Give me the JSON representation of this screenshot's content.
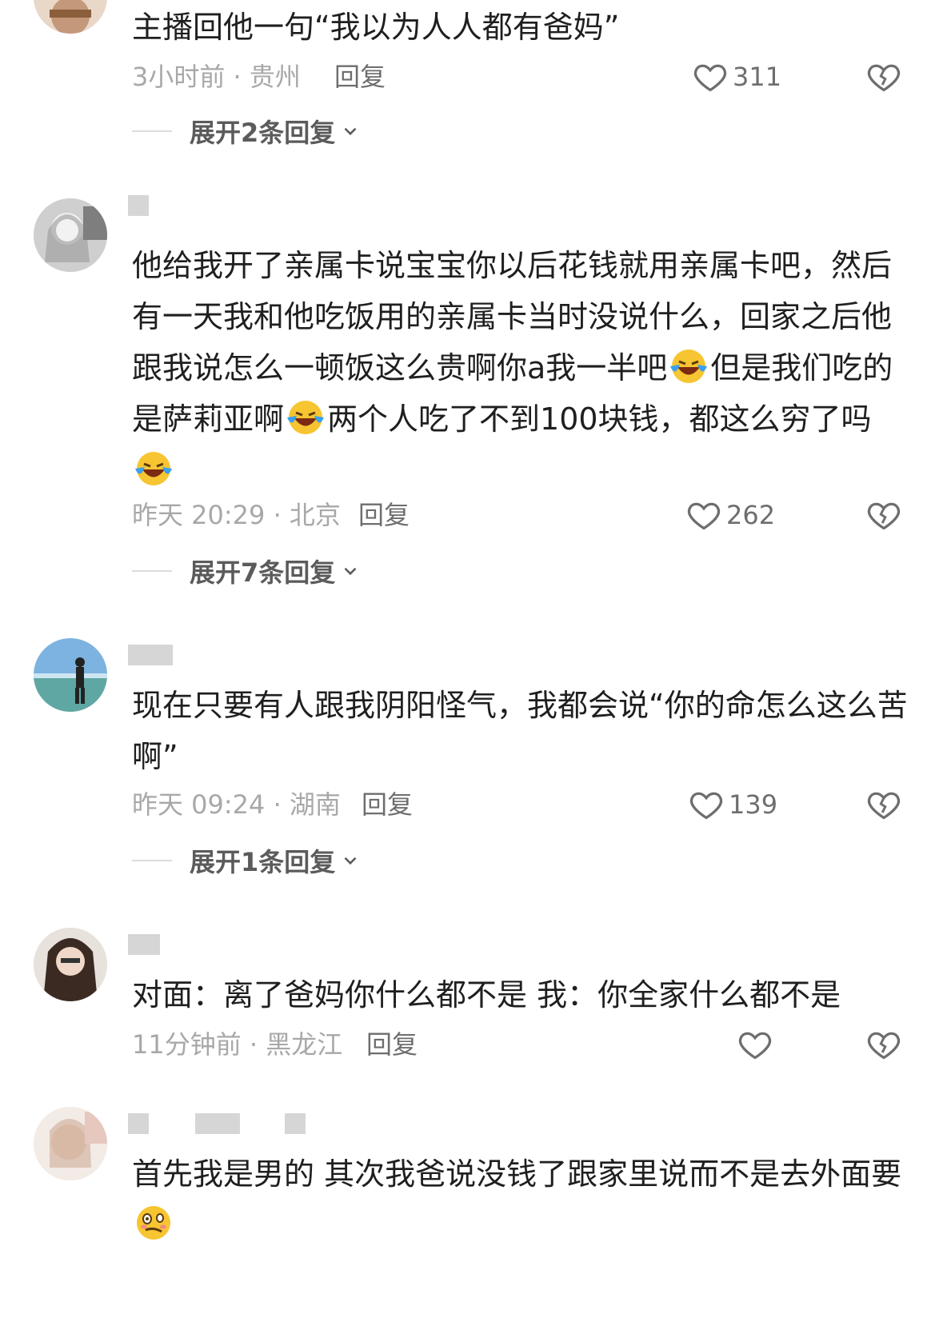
{
  "comments": [
    {
      "text": "主播回他一句“我以为人人都有爸妈”",
      "time": "3小时前",
      "location": "贵州",
      "reply_label": "回复",
      "likes": "311",
      "expand_label": "展开2条回复"
    },
    {
      "text_parts": [
        "他给我开了亲属卡说宝宝你以后花钱就用亲属卡吧，然后有一天我和他吃饭用的亲属卡当时没说什么，回家之后他跟我说怎么一顿饭这么贵啊你a我一半吧",
        "但是我们吃的是萨莉亚啊",
        "两个人吃了不到100块钱，都这么穷了吗"
      ],
      "emoji": "laughing-crying-emoji",
      "time": "昨天 20:29",
      "location": "北京",
      "reply_label": "回复",
      "likes": "262",
      "expand_label": "展开7条回复"
    },
    {
      "text": "现在只要有人跟我阴阳怪气，我都会说“你的命怎么这么苦啊”",
      "time": "昨天 09:24",
      "location": "湖南",
      "reply_label": "回复",
      "likes": "139",
      "expand_label": "展开1条回复"
    },
    {
      "text": "对面：离了爸妈你什么都不是 我：你全家什么都不是",
      "time": "11分钟前",
      "location": "黑龙江",
      "reply_label": "回复",
      "likes": ""
    },
    {
      "text": "首先我是男的 其次我爸说没钱了跟家里说而不是去外面要",
      "emoji": "woozy-face-emoji"
    }
  ],
  "separator": " · ",
  "colors": {
    "text": "#1f1f1f",
    "meta": "#a8a8a8",
    "action": "#6e6e6e",
    "emoji_face": "#f7c531",
    "emoji_tears": "#3aa0f0"
  }
}
